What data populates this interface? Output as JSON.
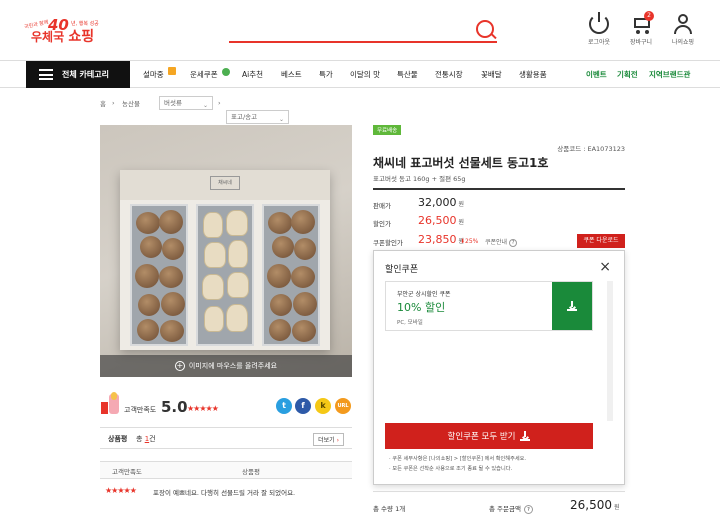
{
  "header": {
    "logo": {
      "anniversary": "40",
      "tagline_left": "국민과 함께",
      "tagline_right": "년, 행복 성공",
      "name_prefix": "우체국",
      "name_main": "쇼핑"
    },
    "search": {
      "placeholder": ""
    },
    "buttons": {
      "logout": "로그아웃",
      "cart": "장바구니",
      "cart_count": "2",
      "my": "나의쇼핑"
    }
  },
  "nav": {
    "all_categories": "전체 카테고리",
    "items": [
      "설마중",
      "운세쿠폰",
      "Ai추천",
      "베스트",
      "특가",
      "이달의 맛",
      "특산물",
      "전통시장",
      "꽃배달",
      "생활용품"
    ],
    "right_items": [
      "이벤트",
      "기획전",
      "지역브랜드관"
    ]
  },
  "breadcrumb": {
    "home": "홈",
    "level1": "농산물",
    "level2": "버섯류",
    "level3": "표고/송고"
  },
  "image": {
    "hover_hint": "이미지에 마우스를 올려주세요",
    "box_label": "채씨네"
  },
  "rating": {
    "label": "고객만족도",
    "score": "5.0",
    "stars": "★★★★★"
  },
  "share": {
    "twitter": "t",
    "facebook": "f",
    "kakao": "k",
    "url": "URL"
  },
  "reviews": {
    "tab_label": "상품평",
    "count_prefix": "총",
    "count": "1",
    "count_suffix": "건",
    "more_button": "더보기",
    "col_rating": "고객만족도",
    "col_review": "상품평",
    "rows": [
      {
        "stars": "★★★★★",
        "text": "포장이 예쁘네요. 다행히 선물드릴 거라 잘 되었어요."
      }
    ]
  },
  "product": {
    "badge": "무료배송",
    "code_label": "상품코드 : EA1073123",
    "title": "채씨네 표고버섯 선물세트 동고1호",
    "subtitle": "표고버섯 동고 160g + 절편 65g",
    "price_label": "판매가",
    "price": "32,000",
    "sale_label": "할인가",
    "sale_price": "26,500",
    "coupon_label": "쿠폰할인가",
    "coupon_price": "23,850",
    "discount_rate": "25%",
    "coupon_info": "쿠폰안내",
    "coupon_download": "쿠폰 다운로드",
    "currency": "원"
  },
  "coupon_panel": {
    "title": "할인쿠폰",
    "coupon_name": "부안군 상시할인 쿠폰",
    "coupon_discount": "10% 할인",
    "coupon_platform": "PC, 모바일",
    "get_all": "할인쿠폰 모두 받기",
    "note1": "· 쿠폰 세부사항은 [나의쇼핑] > [할인쿠폰] 에서 확인해주세요.",
    "note2": "· 모든 쿠폰은 선착순 사용으로 조기 종료 될 수 있습니다."
  },
  "totals": {
    "qty_label": "총 수량 1개",
    "total_label": "총 주문금액",
    "total": "26,500",
    "currency": "원"
  },
  "colors": {
    "brand_red": "#e8342a",
    "coupon_green": "#1a8a3a",
    "button_red": "#d0211c"
  }
}
